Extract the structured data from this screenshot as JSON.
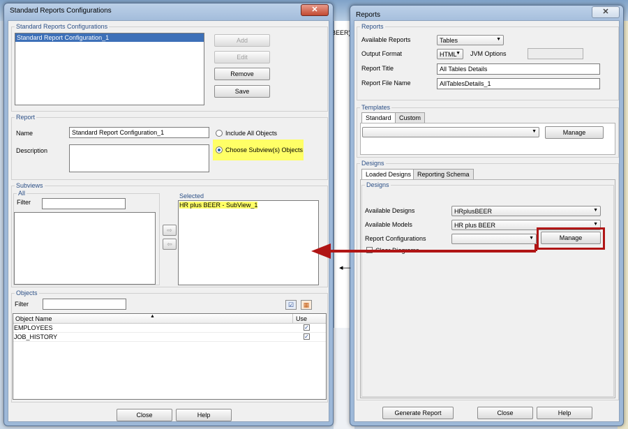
{
  "left_window": {
    "title": "Standard Reports Configurations",
    "configs_legend": "Standard Reports Configurations",
    "configs_list": [
      "Standard Report Configuration_1"
    ],
    "add_label": "Add",
    "edit_label": "Edit",
    "remove_label": "Remove",
    "save_label": "Save",
    "report_legend": "Report",
    "name_label": "Name",
    "name_value": "Standard Report Configuration_1",
    "description_label": "Description",
    "include_all_label": "Include All Objects",
    "choose_subviews_label": "Choose Subview(s) Objects",
    "subviews_legend": "Subviews",
    "all_legend": "All",
    "filter_label": "Filter",
    "selected_legend": "Selected",
    "selected_items": [
      "HR plus BEER - SubView_1"
    ],
    "objects_legend": "Objects",
    "objects_filter_label": "Filter",
    "col_object_name": "Object Name",
    "col_use": "Use",
    "objects": [
      {
        "name": "EMPLOYEES",
        "use": true
      },
      {
        "name": "JOB_HISTORY",
        "use": true
      }
    ],
    "close_label": "Close",
    "help_label": "Help"
  },
  "right_window": {
    "title": "Reports",
    "reports_legend": "Reports",
    "available_reports_label": "Available Reports",
    "available_reports_value": "Tables",
    "output_format_label": "Output Format",
    "output_format_value": "HTML",
    "jvm_options_label": "JVM Options",
    "report_title_label": "Report Title",
    "report_title_value": "All Tables Details",
    "report_file_label": "Report File Name",
    "report_file_value": "AllTablesDetails_1",
    "templates_legend": "Templates",
    "tab_standard": "Standard",
    "tab_custom": "Custom",
    "manage_label": "Manage",
    "designs_legend": "Designs",
    "tab_loaded_designs": "Loaded Designs",
    "tab_reporting_schema": "Reporting Schema",
    "inner_designs_legend": "Designs",
    "available_designs_label": "Available Designs",
    "available_designs_value": "HRplusBEER",
    "available_models_label": "Available Models",
    "available_models_value": "HR plus BEER",
    "report_configs_label": "Report Configurations",
    "manage2_label": "Manage",
    "clear_diagrams_label": "Clear Diagrams",
    "generate_label": "Generate Report",
    "close_label": "Close",
    "help_label": "Help"
  },
  "background": {
    "partial_text": "BEER)"
  },
  "colors": {
    "highlight": "#ffff66",
    "callout_red": "#b01515"
  }
}
